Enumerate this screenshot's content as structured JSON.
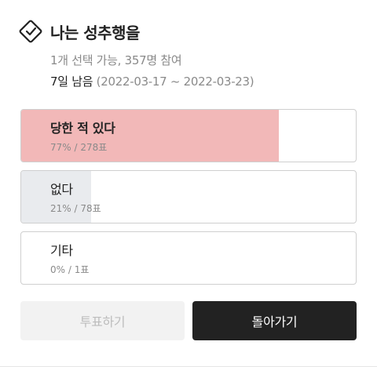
{
  "poll": {
    "title": "나는 성추행을",
    "meta": "1개 선택 가능, 357명 참여",
    "remaining": "7일 남음",
    "period": " (2022-03-17 ~ 2022-03-23)",
    "options": [
      {
        "label": "당한 적 있다",
        "stats": "77% / 278표",
        "fraction": 0.77,
        "color": "#f2b8b8",
        "selected": true
      },
      {
        "label": "없다",
        "stats": "21% / 78표",
        "fraction": 0.21,
        "color": "#e9ebee",
        "selected": false
      },
      {
        "label": "기타",
        "stats": "0% / 1표",
        "fraction": 0.0,
        "color": "#e9ebee",
        "selected": false
      }
    ]
  },
  "buttons": {
    "vote_label": "투표하기",
    "back_label": "돌아가기"
  },
  "icons": {
    "poll": "vote-box-icon"
  }
}
